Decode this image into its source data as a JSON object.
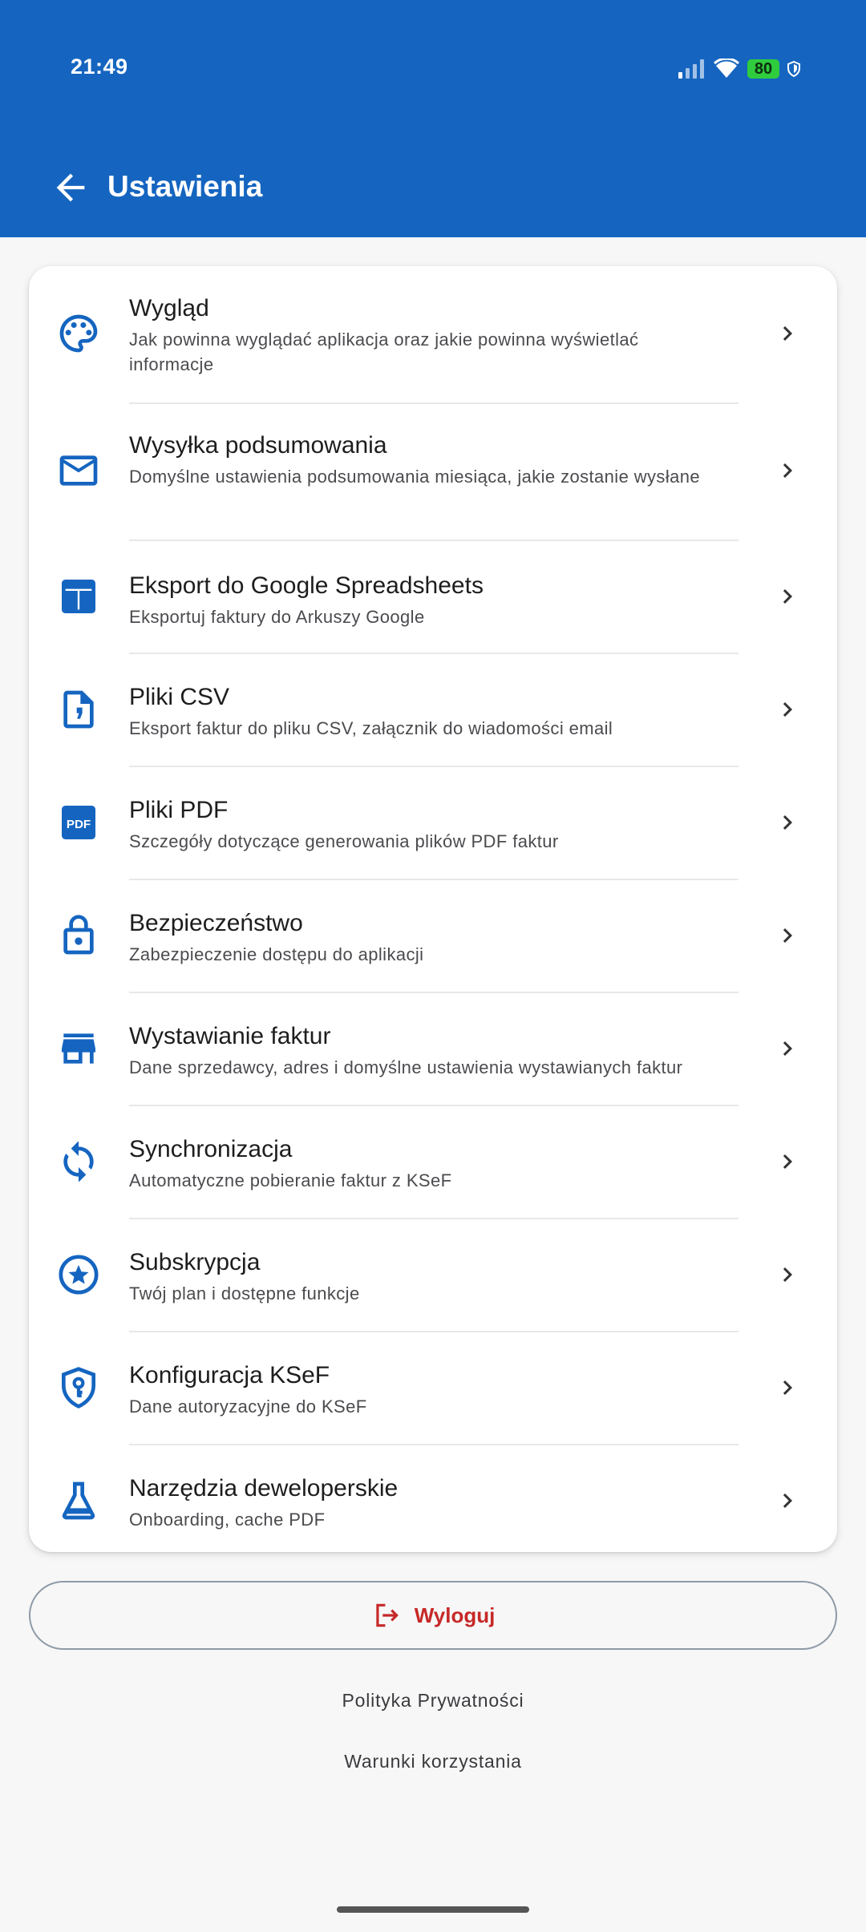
{
  "status_bar": {
    "time": "21:49",
    "battery": "80"
  },
  "header": {
    "title": "Ustawienia",
    "background_color": "#1565c0"
  },
  "settings_items": [
    {
      "icon": "palette-icon",
      "title": "Wygląd",
      "subtitle": "Jak powinna wyglądać aplikacja oraz jakie powinna wyświetlać informacje"
    },
    {
      "icon": "mail-icon",
      "title": "Wysyłka podsumowania",
      "subtitle": "Domyślne ustawienia podsumowania miesiąca, jakie zostanie wysłane"
    },
    {
      "icon": "spreadsheet-icon",
      "title": "Eksport do Google Spreadsheets",
      "subtitle": "Eksportuj faktury do Arkuszy Google"
    },
    {
      "icon": "csv-file-icon",
      "title": "Pliki CSV",
      "subtitle": "Eksport faktur do pliku CSV, załącznik do wiadomości email"
    },
    {
      "icon": "pdf-icon",
      "title": "Pliki PDF",
      "subtitle": "Szczegóły dotyczące generowania plików PDF faktur"
    },
    {
      "icon": "lock-icon",
      "title": "Bezpieczeństwo",
      "subtitle": "Zabezpieczenie dostępu do aplikacji"
    },
    {
      "icon": "store-icon",
      "title": "Wystawianie faktur",
      "subtitle": "Dane sprzedawcy, adres i domyślne ustawienia wystawianych faktur"
    },
    {
      "icon": "sync-icon",
      "title": "Synchronizacja",
      "subtitle": "Automatyczne pobieranie faktur z KSeF"
    },
    {
      "icon": "star-circle-icon",
      "title": "Subskrypcja",
      "subtitle": "Twój plan i dostępne funkcje"
    },
    {
      "icon": "shield-key-icon",
      "title": "Konfiguracja KSeF",
      "subtitle": "Dane autoryzacyjne do KSeF"
    },
    {
      "icon": "flask-icon",
      "title": "Narzędzia deweloperskie",
      "subtitle": "Onboarding, cache PDF"
    }
  ],
  "logout": {
    "label": "Wyloguj",
    "color": "#c62828"
  },
  "footer_links": {
    "privacy": "Polityka Prywatności",
    "terms": "Warunki korzystania"
  }
}
